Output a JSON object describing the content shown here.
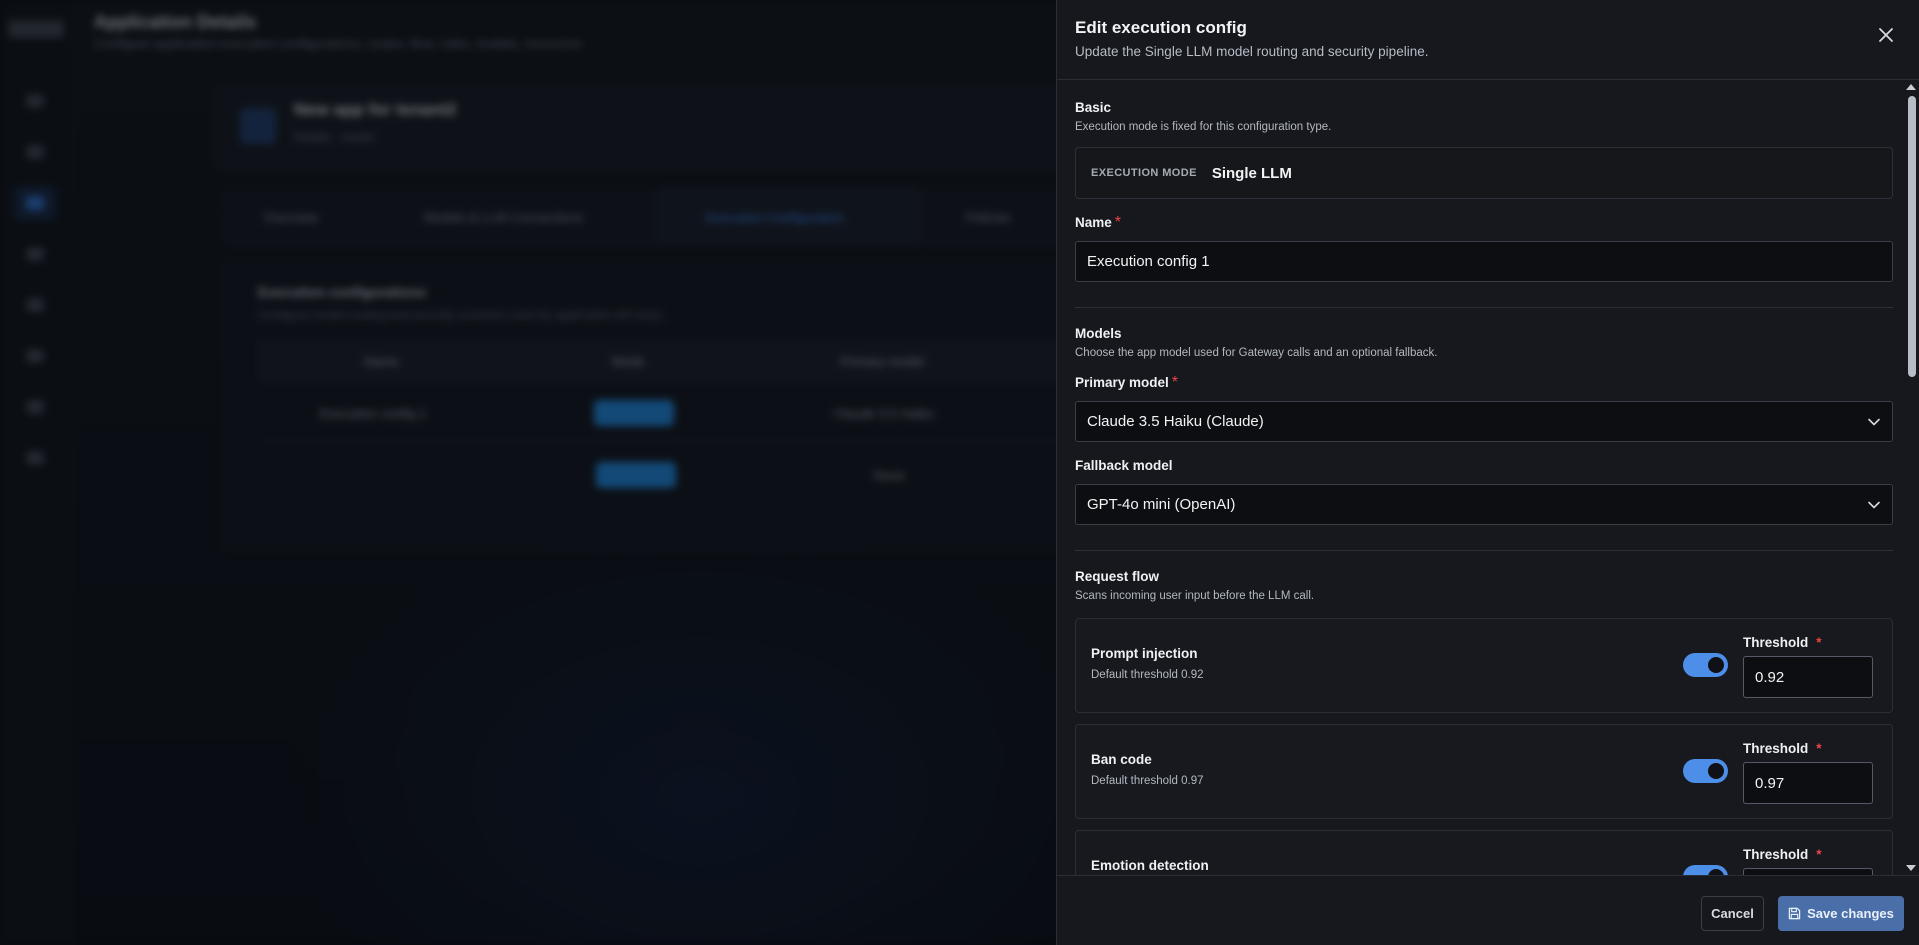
{
  "background": {
    "header_title": "Application Details",
    "header_subtitle": "Configure application execution configurations, routes, flow, rules, models, resources",
    "app_name": "New app for tenant2",
    "app_sub": "Details · routes",
    "tabs": [
      "Overview",
      "Models & LLM Connections",
      "Execution Configuration",
      "Policies"
    ],
    "panel_title": "Execution configurations",
    "panel_subtitle": "Configure model routing and security scanners used by application API keys.",
    "table_headers": [
      "Name",
      "Mode",
      "Primary model"
    ],
    "rows": [
      {
        "name": "Execution config 1",
        "model": "Claude 3.5 Haiku"
      },
      {
        "name": "",
        "model": "None"
      }
    ]
  },
  "drawer": {
    "title": "Edit execution config",
    "subtitle": "Update the Single LLM model routing and security pipeline.",
    "basic": {
      "title": "Basic",
      "desc": "Execution mode is fixed for this configuration type.",
      "mode_label": "EXECUTION MODE",
      "mode_value": "Single LLM"
    },
    "name": {
      "label": "Name",
      "required": "*",
      "value": "Execution config 1"
    },
    "models": {
      "title": "Models",
      "desc": "Choose the app model used for Gateway calls and an optional fallback.",
      "primary_label": "Primary model",
      "primary_value": "Claude 3.5 Haiku (Claude)",
      "fallback_label": "Fallback model",
      "fallback_value": "GPT-4o mini (OpenAI)"
    },
    "request_flow": {
      "title": "Request flow",
      "desc": "Scans incoming user input before the LLM call.",
      "threshold_label": "Threshold",
      "scanners": [
        {
          "name": "Prompt injection",
          "default": "Default threshold 0.92",
          "enabled": true,
          "threshold": "0.92"
        },
        {
          "name": "Ban code",
          "default": "Default threshold 0.97",
          "enabled": true,
          "threshold": "0.97"
        },
        {
          "name": "Emotion detection",
          "default": "",
          "enabled": true,
          "threshold": ""
        }
      ]
    },
    "footer": {
      "cancel": "Cancel",
      "save": "Save changes"
    },
    "colors": {
      "accent": "#4d8fe8",
      "save_button": "#4a6fa8",
      "required": "#ef4444"
    }
  }
}
